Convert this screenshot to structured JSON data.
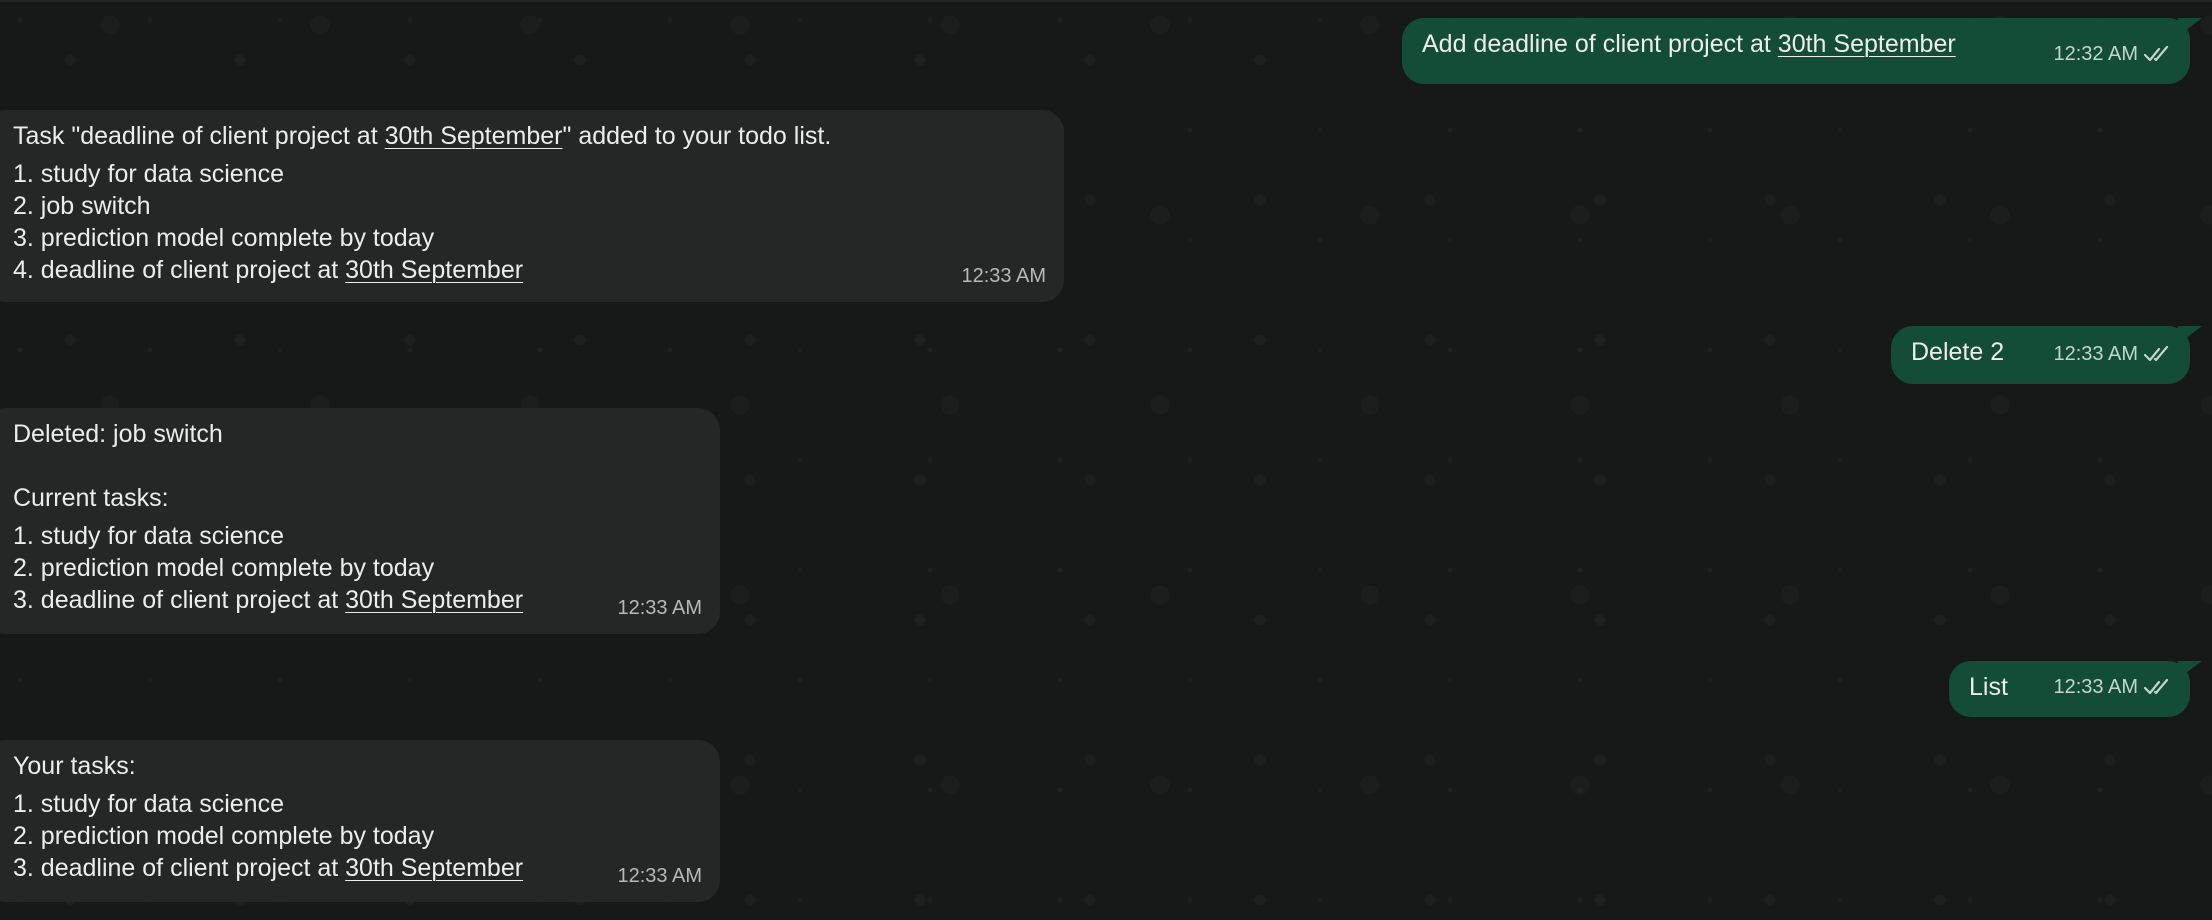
{
  "messages": [
    {
      "id": "m1",
      "direction": "out",
      "text_before": "Add deadline of client project at ",
      "link": "30th September",
      "time": "12:32 AM",
      "status_icon": "double-check-icon"
    },
    {
      "id": "m2",
      "direction": "in",
      "header_before": "Task \"deadline of client project at ",
      "header_link": "30th September",
      "header_after": "\" added to your todo list.",
      "items": [
        "1. study for data science",
        "2. job switch",
        "3. prediction model complete by today"
      ],
      "last_item_before": "4. deadline of client project at ",
      "last_item_link": "30th September",
      "time": "12:33 AM"
    },
    {
      "id": "m3",
      "direction": "out",
      "text": "Delete 2",
      "time": "12:33 AM",
      "status_icon": "double-check-icon"
    },
    {
      "id": "m4",
      "direction": "in",
      "header": "Deleted: job switch",
      "subheader": "Current tasks:",
      "items": [
        "1. study for data science",
        "2. prediction model complete by today"
      ],
      "last_item_before": "3. deadline of client project at ",
      "last_item_link": "30th September",
      "time": "12:33 AM"
    },
    {
      "id": "m5",
      "direction": "out",
      "text": "List",
      "time": "12:33 AM",
      "status_icon": "double-check-icon"
    },
    {
      "id": "m6",
      "direction": "in",
      "header": "Your tasks:",
      "items": [
        "1. study for data science",
        "2. prediction model complete by today"
      ],
      "last_item_before": "3. deadline of client project at ",
      "last_item_link": "30th September",
      "time": "12:33 AM"
    }
  ],
  "colors": {
    "background": "#171818",
    "incoming_bubble": "#252626",
    "outgoing_bubble": "#144d37",
    "text": "#ececec",
    "timestamp": "#b5bab7"
  }
}
